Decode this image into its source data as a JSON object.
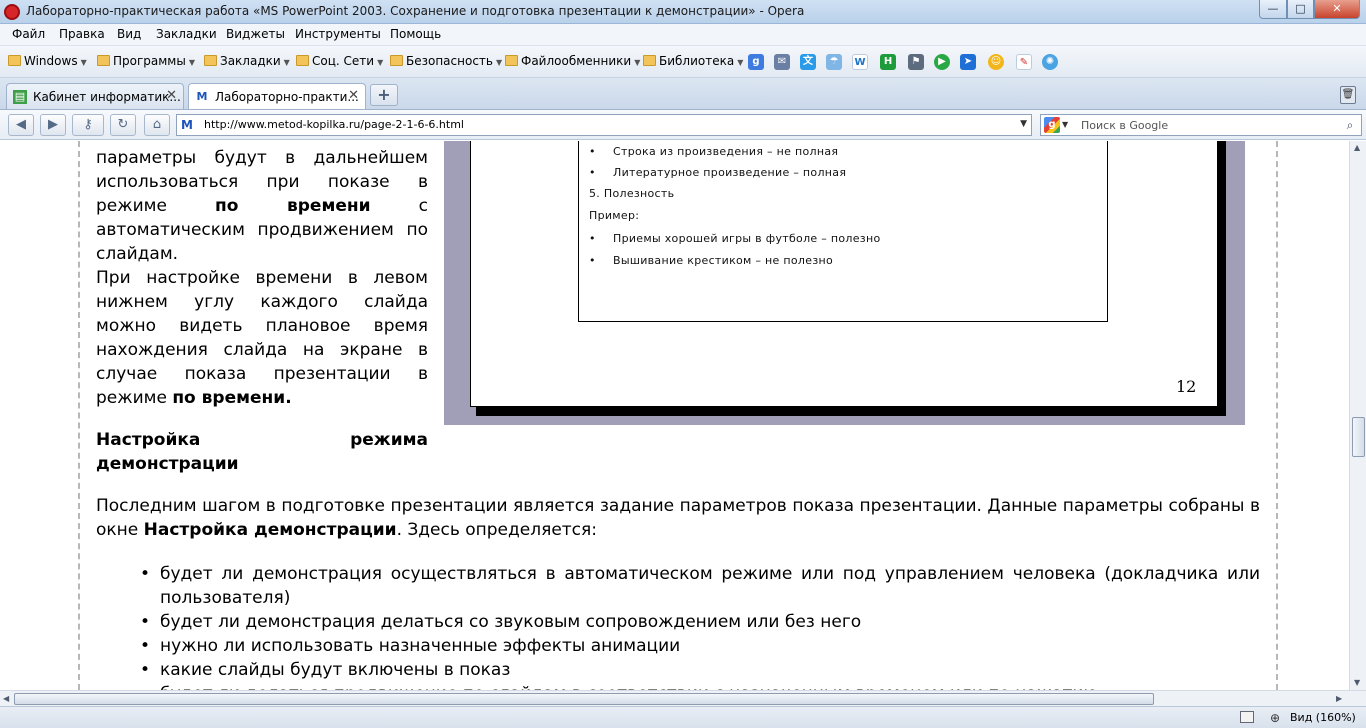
{
  "window": {
    "title": "Лабораторно-практическая работа «MS PowerPoint 2003. Сохранение и подготовка презентации к демонстрации» - Opera",
    "minimize": "—",
    "maximize": "□",
    "close": "✕"
  },
  "menu": [
    "Файл",
    "Правка",
    "Вид",
    "Закладки",
    "Виджеты",
    "Инструменты",
    "Помощь"
  ],
  "bookmarks": {
    "folders": [
      "Windows",
      "Программы",
      "Закладки",
      "Соц. Сети",
      "Безопасность",
      "Файлообменники",
      "Библиотека"
    ],
    "quick_icons": [
      "google-bookmark-icon",
      "mail-icon",
      "translate-icon",
      "weather-icon",
      "wikipedia-icon",
      "h-icon",
      "flag-icon",
      "play-icon",
      "arrow-icon",
      "smile-icon",
      "pen-icon",
      "sunflower-icon"
    ]
  },
  "tabs": [
    {
      "label": "Кабинет информатик...",
      "icon": "book-icon",
      "close": "✕"
    },
    {
      "label": "Лабораторно-практи...",
      "icon": "M",
      "close": "✕"
    }
  ],
  "new_tab": "+",
  "address": {
    "url": "http://www.metod-kopilka.ru/page-2-1-6-6.html",
    "site_icon": "M",
    "search_placeholder": "Поиск в Google"
  },
  "content": {
    "left_column": {
      "line1": "параметры будут в дальнейшем использоваться при показе в режиме ",
      "bold1": "по времени",
      "line1_end": " с автоматическим продвижением по слайдам.",
      "line2": "При настройке времени в левом нижнем углу каждого слайда можно видеть плановое время нахождения слайда на экране в случае показа презентации в режиме ",
      "bold2": "по времени."
    },
    "heading": {
      "part1": "Настройка режима",
      "part2": "демонстрации"
    },
    "paragraph": {
      "text1": "Последним шагом в подготовке презентации является задание параметров показа презентации. Данные параметры собраны в окне ",
      "bold": "Настройка демонстрации",
      "text2": ". Здесь определяется:"
    },
    "list": [
      "будет ли демонстрация осуществляться в автоматическом режиме или под управлением человека (докладчика или пользователя)",
      "будет ли демонстрация делаться со звуковым сопровождением или без него",
      "нужно ли использовать назначенные эффекты анимации",
      "какие слайды будут включены в показ",
      "будет ли делаться продвижение по слайдам в соответствии с назначенным временем или по нажатию"
    ],
    "slide": {
      "lines": [
        "Строка из произведения – не полная",
        "Литературное произведение – полная",
        "5. Полезность",
        "Пример:",
        "Приемы хорошей игры в футболе – полезно",
        "Вышивание крестиком – не полезно"
      ],
      "page_number": "12"
    }
  },
  "status": {
    "zoom": "Вид (160%)"
  }
}
